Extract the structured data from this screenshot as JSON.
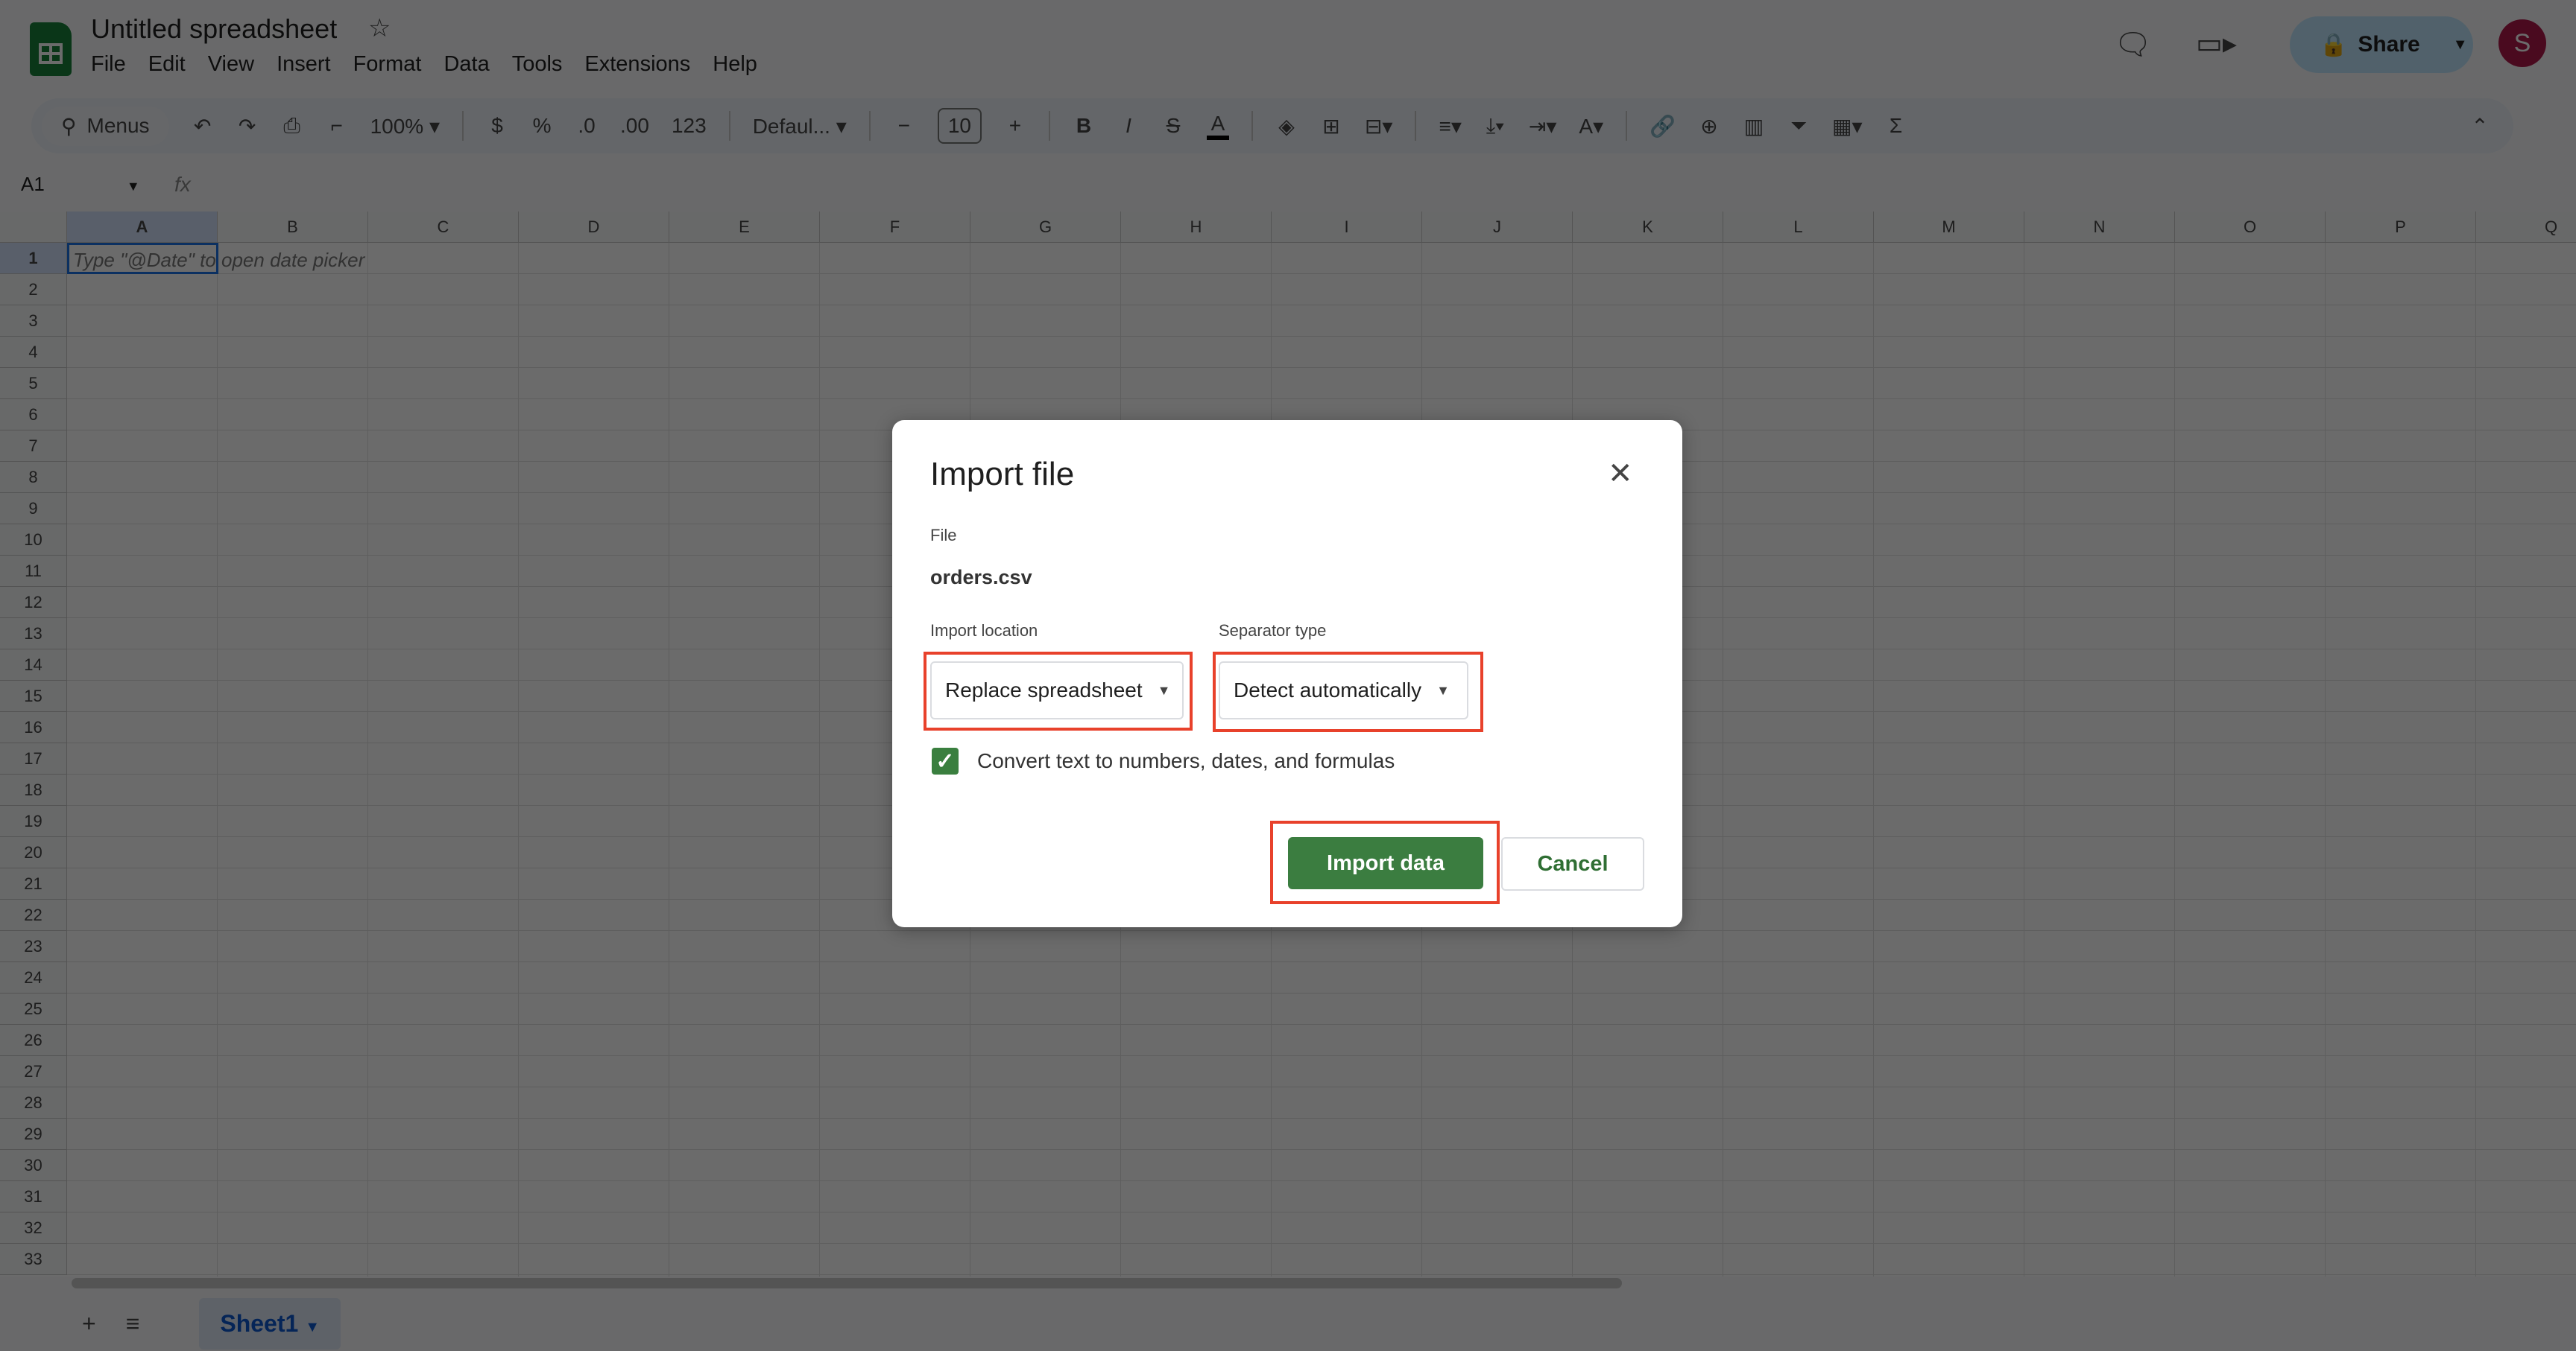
{
  "app": {
    "title": "Untitled spreadsheet",
    "menu": [
      "File",
      "Edit",
      "View",
      "Insert",
      "Format",
      "Data",
      "Tools",
      "Extensions",
      "Help"
    ],
    "share_label": "Share",
    "avatar_initial": "S"
  },
  "toolbar": {
    "menus_label": "Menus",
    "zoom": "100%",
    "currency": "$",
    "percent": "%",
    "dec_decrease": ".0",
    "dec_increase": ".00",
    "number_format": "123",
    "font": "Defaul...",
    "font_size": "10",
    "bold": "B",
    "italic": "I",
    "strike": "S",
    "text_color": "A",
    "sum": "Σ"
  },
  "formula_bar": {
    "name_box": "A1",
    "fx": "fx"
  },
  "grid": {
    "columns": [
      "A",
      "B",
      "C",
      "D",
      "E",
      "F",
      "G",
      "H",
      "I",
      "J",
      "K",
      "L",
      "M",
      "N",
      "O",
      "P",
      "Q"
    ],
    "rows": [
      "1",
      "2",
      "3",
      "4",
      "5",
      "6",
      "7",
      "8",
      "9",
      "10",
      "11",
      "12",
      "13",
      "14",
      "15",
      "16",
      "17",
      "18",
      "19",
      "20",
      "21",
      "22",
      "23",
      "24",
      "25",
      "26",
      "27",
      "28",
      "29",
      "30",
      "31",
      "32",
      "33"
    ],
    "a1_hint": "Type \"@Date\" to open date picker"
  },
  "sheets": {
    "active": "Sheet1"
  },
  "dialog": {
    "title": "Import file",
    "file_label": "File",
    "file_name": "orders.csv",
    "location_label": "Import location",
    "location_value": "Replace spreadsheet",
    "separator_label": "Separator type",
    "separator_value": "Detect automatically",
    "convert_label": "Convert text to numbers, dates, and formulas",
    "convert_checked": true,
    "import_button": "Import data",
    "cancel_button": "Cancel"
  },
  "colors": {
    "accent": "#3b7d40",
    "highlight": "#e8412b",
    "selection": "#1a73e8"
  }
}
